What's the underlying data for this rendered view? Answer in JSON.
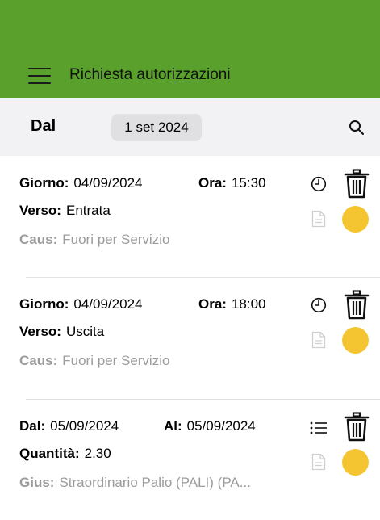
{
  "header": {
    "title": "Richiesta autorizzazioni",
    "background": "#5aa02c"
  },
  "filter": {
    "dal_label": "Dal",
    "date_value": "1 set 2024"
  },
  "records": [
    {
      "l1": "Giorno:",
      "v1": "04/09/2024",
      "l2": "Ora:",
      "v2": "15:30",
      "l3": "Verso:",
      "v3": "Entrata",
      "l4": "Caus:",
      "v4": "Fuori per Servizio",
      "type_icon": "clock-icon",
      "status_color": "#f4c531"
    },
    {
      "l1": "Giorno:",
      "v1": "04/09/2024",
      "l2": "Ora:",
      "v2": "18:00",
      "l3": "Verso:",
      "v3": "Uscita",
      "l4": "Caus:",
      "v4": "Fuori per Servizio",
      "type_icon": "clock-icon",
      "status_color": "#f4c531"
    },
    {
      "l1": "Dal:",
      "v1": "05/09/2024",
      "l2": "Al:",
      "v2": "05/09/2024",
      "l3": "Quantità:",
      "v3": "2.30",
      "l4": "Gius:",
      "v4": "Straordinario Palio (PALI) (PA...",
      "type_icon": "list-icon",
      "status_color": "#f4c531"
    }
  ]
}
